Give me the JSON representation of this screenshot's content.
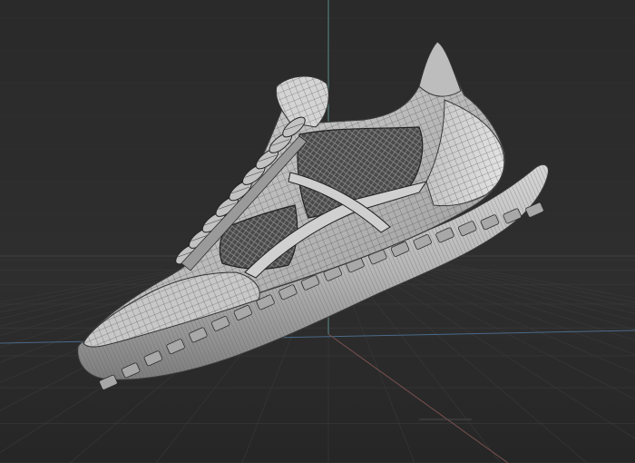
{
  "viewport": {
    "background": "#2b2b2b",
    "grid_color": "#3a3a3a",
    "grid_major_color": "#404040",
    "axis_y_color": "#5a8a8a",
    "axis_x_color": "#7a5050",
    "axis_z_color": "#4a6a8a"
  },
  "model": {
    "name_icon": "sneaker-wireframe-model",
    "shade_light": "#c9c9c9",
    "shade_mid": "#9a9a9a",
    "shade_dark": "#5a5a5a",
    "wire_color": "#2f2f2f"
  }
}
